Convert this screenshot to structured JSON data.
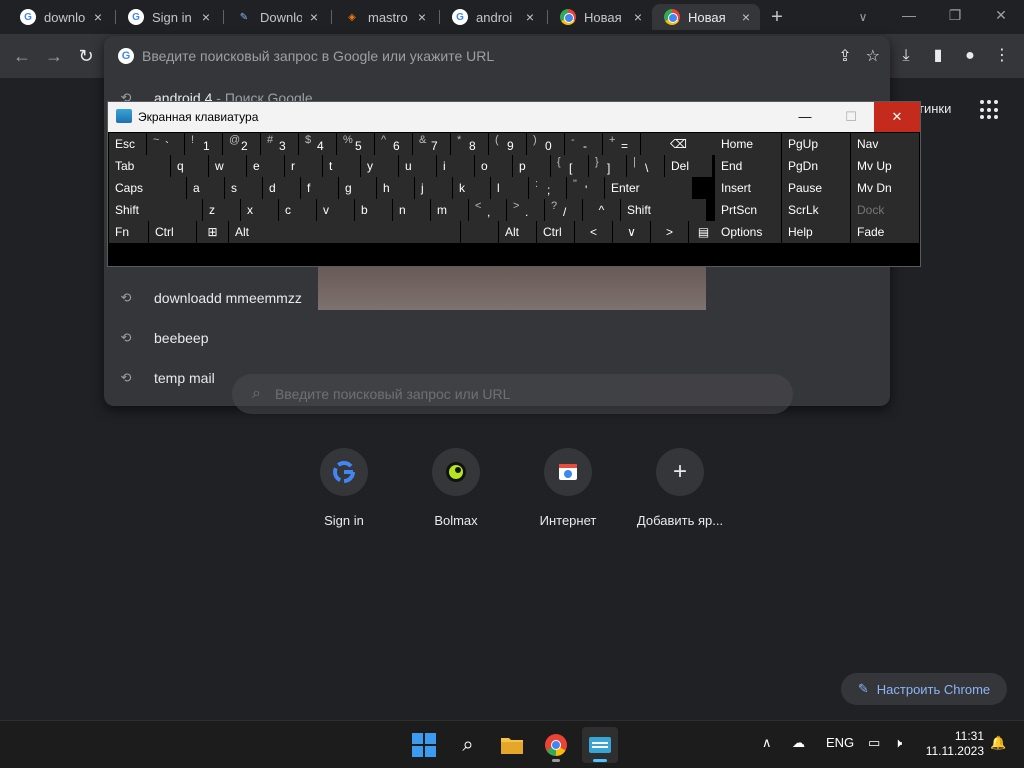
{
  "browser": {
    "tabs": [
      {
        "title": "downlo",
        "icon": "google-icon"
      },
      {
        "title": "Sign in",
        "icon": "google-icon"
      },
      {
        "title": "Downlo",
        "icon": "site-icon"
      },
      {
        "title": "mastro",
        "icon": "site-icon"
      },
      {
        "title": "androi",
        "icon": "google-icon"
      },
      {
        "title": "Новая",
        "icon": "chrome-icon"
      },
      {
        "title": "Новая",
        "icon": "chrome-icon"
      }
    ],
    "new_tab_symbol": "+",
    "address_placeholder": "Введите поисковый запрос в Google или укажите URL"
  },
  "omnibox": {
    "suggestions": [
      {
        "text": "android 4.",
        "sub": " - Поиск Google"
      },
      {
        "text": "downloadd mmeemmzz",
        "sub": ""
      },
      {
        "text": "beebeep",
        "sub": ""
      },
      {
        "text": "temp mail",
        "sub": ""
      }
    ]
  },
  "ntp": {
    "gbar_text": "тинки",
    "search_placeholder": "Введите поисковый запрос или URL",
    "shortcuts": [
      {
        "label": "Sign in",
        "icon": "google-icon"
      },
      {
        "label": "Bolmax",
        "icon": "bolmax-icon"
      },
      {
        "label": "Интернет",
        "icon": "site-icon"
      },
      {
        "label": "Добавить яр...",
        "icon": "plus-icon"
      }
    ],
    "customize_label": "Настроить Chrome"
  },
  "osk": {
    "title": "Экранная клавиатура",
    "rows": [
      [
        "Esc",
        "~ `",
        "! 1",
        "@ 2",
        "# 3",
        "$ 4",
        "% 5",
        "^ 6",
        "& 7",
        "* 8",
        "( 9",
        ") 0",
        "- -",
        "+ =",
        "⌫"
      ],
      [
        "Tab",
        "q",
        "w",
        "e",
        "r",
        "t",
        "y",
        "u",
        "i",
        "o",
        "p",
        "{ [",
        "} ]",
        "| \\",
        "Del"
      ],
      [
        "Caps",
        "a",
        "s",
        "d",
        "f",
        "g",
        "h",
        "j",
        "k",
        "l",
        ": ;",
        "\" '",
        "Enter"
      ],
      [
        "Shift",
        "z",
        "x",
        "c",
        "v",
        "b",
        "n",
        "m",
        "< ,",
        "> .",
        "? /",
        "^",
        "Shift"
      ],
      [
        "Fn",
        "Ctrl",
        "⊞",
        "Alt",
        "",
        "Alt",
        "Ctrl",
        "<",
        "∨",
        ">",
        "▤"
      ]
    ],
    "nav_rows": [
      [
        "Home",
        "PgUp",
        "Nav"
      ],
      [
        "End",
        "PgDn",
        "Mv Up"
      ],
      [
        "Insert",
        "Pause",
        "Mv Dn"
      ],
      [
        "PrtScn",
        "ScrLk",
        "Dock"
      ],
      [
        "Options",
        "Help",
        "Fade"
      ]
    ]
  },
  "taskbar": {
    "language": "ENG",
    "time": "11:31",
    "date": "11.11.2023"
  },
  "colors": {
    "accent": "#8ab4f8",
    "close_red": "#c42b1c",
    "windows_blue": "#3a9bf0"
  }
}
